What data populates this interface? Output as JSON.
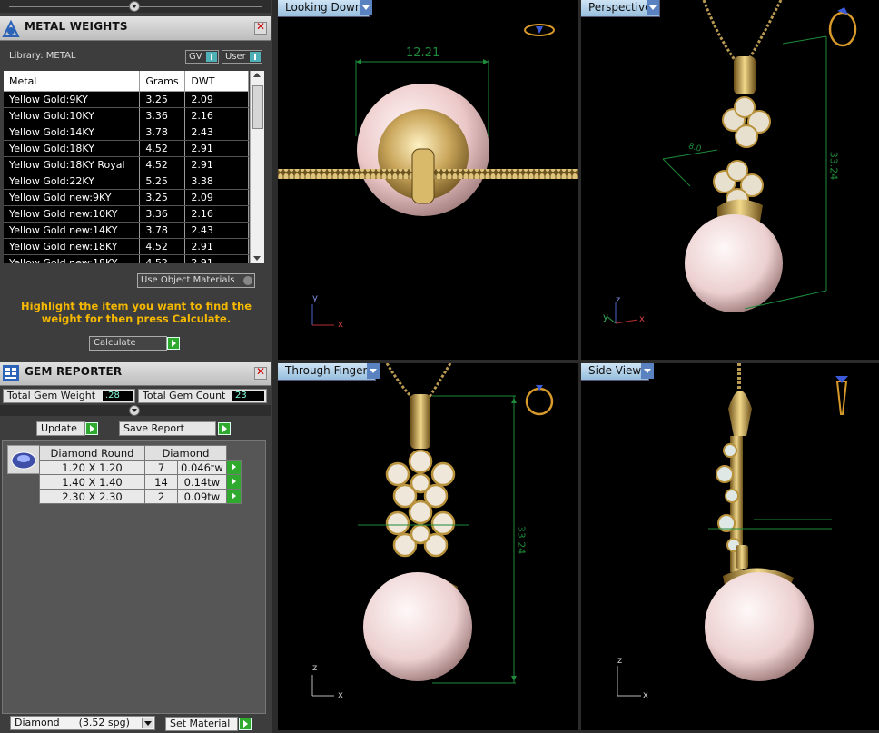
{
  "metal_panel": {
    "title": "METAL WEIGHTS",
    "library_label": "Library: METAL",
    "gv_label": "GV",
    "user_label": "User",
    "columns": [
      "Metal",
      "Grams",
      "DWT"
    ],
    "rows": [
      {
        "metal": "Yellow Gold:9KY",
        "grams": "3.25",
        "dwt": "2.09"
      },
      {
        "metal": "Yellow Gold:10KY",
        "grams": "3.36",
        "dwt": "2.16"
      },
      {
        "metal": "Yellow Gold:14KY",
        "grams": "3.78",
        "dwt": "2.43"
      },
      {
        "metal": "Yellow Gold:18KY",
        "grams": "4.52",
        "dwt": "2.91"
      },
      {
        "metal": "Yellow Gold:18KY Royal",
        "grams": "4.52",
        "dwt": "2.91"
      },
      {
        "metal": "Yellow Gold:22KY",
        "grams": "5.25",
        "dwt": "3.38"
      },
      {
        "metal": "Yellow Gold new:9KY",
        "grams": "3.25",
        "dwt": "2.09"
      },
      {
        "metal": "Yellow Gold new:10KY",
        "grams": "3.36",
        "dwt": "2.16"
      },
      {
        "metal": "Yellow Gold new:14KY",
        "grams": "3.78",
        "dwt": "2.43"
      },
      {
        "metal": "Yellow Gold new:18KY",
        "grams": "4.52",
        "dwt": "2.91"
      },
      {
        "metal": "Yellow Gold new:18KY...",
        "grams": "4.52",
        "dwt": "2.91"
      }
    ],
    "use_object_materials": "Use Object Materials",
    "hint": "Highlight the item you want to find the weight for then press Calculate.",
    "calculate_label": "Calculate"
  },
  "gem_panel": {
    "title": "GEM REPORTER",
    "total_weight_label": "Total Gem Weight",
    "total_weight_value": ".28",
    "total_count_label": "Total Gem Count",
    "total_count_value": "23",
    "update_label": "Update",
    "save_report_label": "Save Report",
    "table_header_shape": "Diamond Round",
    "table_header_material": "Diamond",
    "rows": [
      {
        "size": "1.20 X 1.20",
        "count": "7",
        "weight": "0.046tw"
      },
      {
        "size": "1.40 X 1.40",
        "count": "14",
        "weight": "0.14tw"
      },
      {
        "size": "2.30 X 2.30",
        "count": "2",
        "weight": "0.09tw"
      }
    ]
  },
  "bottom_bar": {
    "material_select": "Diamond      (3.52 spg)",
    "set_material_label": "Set Material"
  },
  "viewports": {
    "top_left": {
      "label": "Looking Down",
      "dimension": "12.21"
    },
    "top_right": {
      "label": "Perspective",
      "dimension": "33.24",
      "dimension2": "8.0"
    },
    "bottom_left": {
      "label": "Through Finger",
      "dimension": "33.24"
    },
    "bottom_right": {
      "label": "Side View"
    }
  },
  "axes": {
    "x": "x",
    "y": "y",
    "z": "z"
  },
  "colors": {
    "accent_yellow": "#f5b800",
    "dimension_green": "#1e8a3a",
    "gold": "#d8b664",
    "pearl": "#f0d6d6"
  }
}
